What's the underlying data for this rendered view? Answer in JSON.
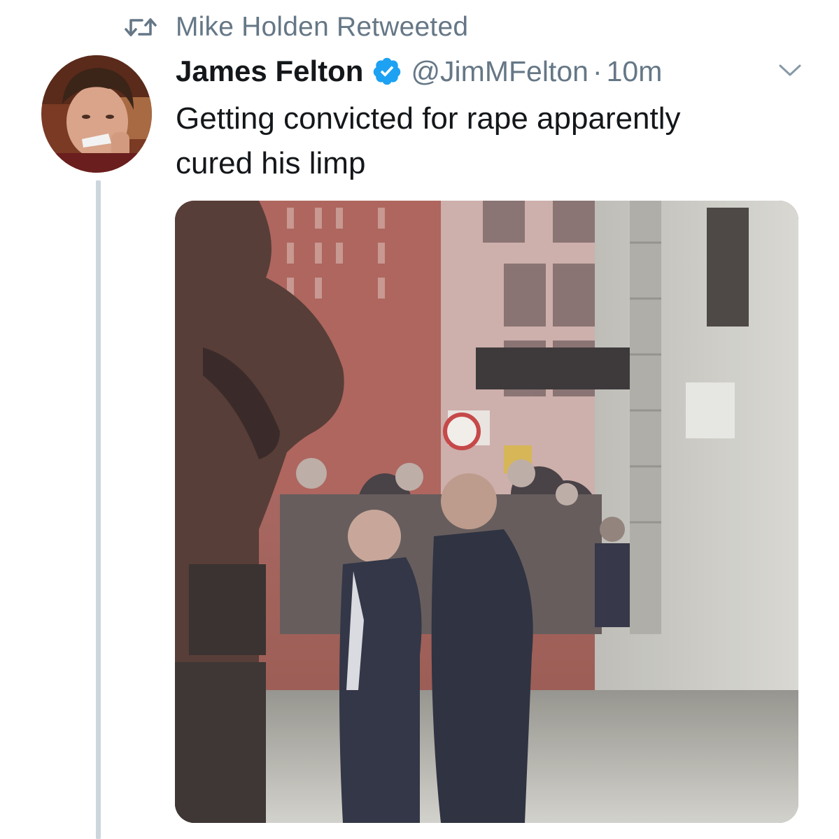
{
  "retweet": {
    "icon": "retweet-icon",
    "label": "Mike Holden Retweeted"
  },
  "tweet": {
    "author": {
      "display_name": "James Felton",
      "verified": true,
      "handle": "@JimMFelton",
      "avatar_icon": "avatar-photo"
    },
    "separator": "·",
    "timestamp": "10m",
    "text_line_1": "Getting convicted for rape apparently",
    "text_line_2": "cured his limp",
    "menu_icon": "chevron-down-icon",
    "media": {
      "type": "video-still",
      "description_icon": "street-scene-photo"
    }
  },
  "colors": {
    "primary_text": "#14171a",
    "secondary_text": "#657786",
    "verified_blue": "#1da1f2",
    "thread_line": "#ccd6dd"
  }
}
